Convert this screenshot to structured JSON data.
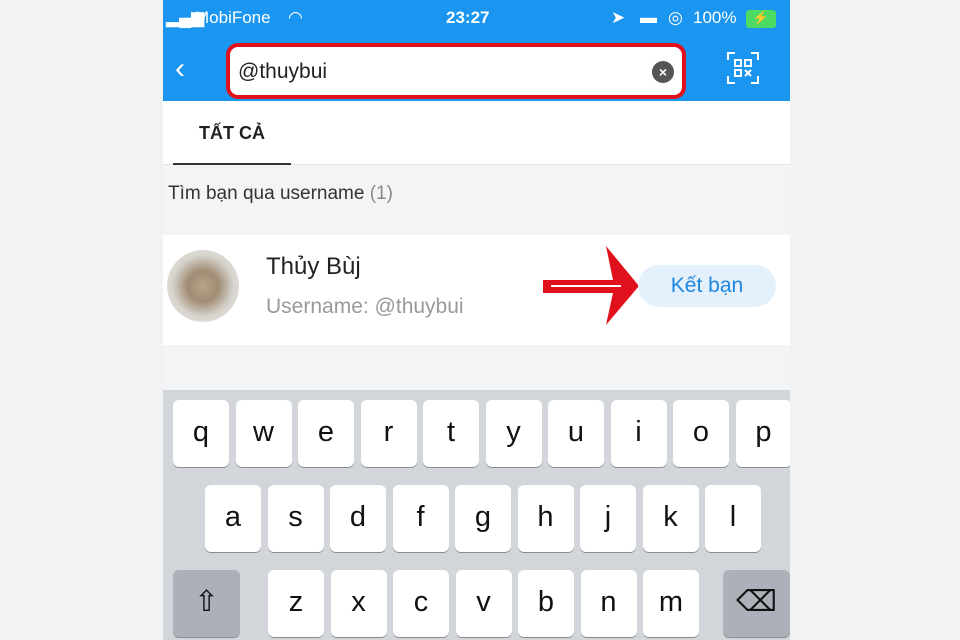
{
  "status": {
    "carrier": "MobiFone",
    "time": "23:27",
    "battery": "100%"
  },
  "search": {
    "value": "@thuybui"
  },
  "tabs": [
    {
      "label": "TẤT CẢ",
      "active": true
    }
  ],
  "section": {
    "label": "Tìm bạn qua username",
    "count": "(1)"
  },
  "result": {
    "name": "Thủy Bùj",
    "username": "Username: @thuybui",
    "action": "Kết bạn"
  },
  "keyboard": {
    "rows": [
      [
        "q",
        "w",
        "e",
        "r",
        "t",
        "y",
        "u",
        "i",
        "o",
        "p"
      ],
      [
        "a",
        "s",
        "d",
        "f",
        "g",
        "h",
        "j",
        "k",
        "l"
      ],
      [
        "z",
        "x",
        "c",
        "v",
        "b",
        "n",
        "m"
      ]
    ],
    "shift": "⇧",
    "backspace": "⌫"
  },
  "colors": {
    "header": "#1a96f0",
    "highlight": "#e0101c",
    "action": "#1f86e0"
  }
}
